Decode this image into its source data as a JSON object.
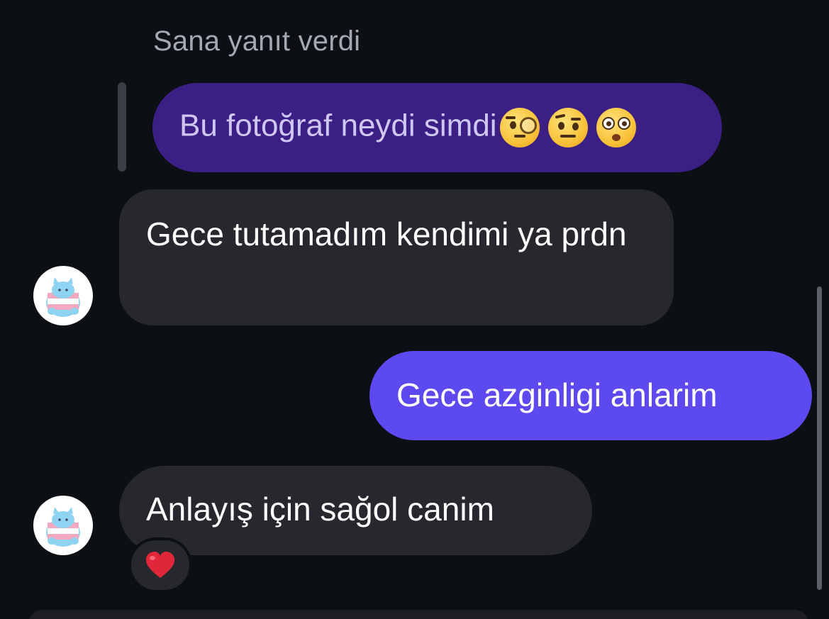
{
  "reply_context": {
    "label": "Sana yanıt verdi",
    "quoted_message": "Bu fotoğraf neydi simdi",
    "quoted_emojis": [
      "face-with-monocle-emoji",
      "face-with-raised-eyebrow-emoji",
      "flushed-face-emoji"
    ]
  },
  "messages": [
    {
      "direction": "incoming",
      "text": "Gece tutamadım kendimi ya prdn"
    },
    {
      "direction": "outgoing",
      "text": "Gece azginligi anlarim"
    },
    {
      "direction": "incoming",
      "text": "Anlayış için sağol canim",
      "reaction": "heart-emoji"
    }
  ],
  "colors": {
    "background": "#0c0f14",
    "incoming_bubble": "#26282e",
    "outgoing_bubble": "#5c4af0",
    "quoted_bubble": "#3b1f85",
    "quoted_text": "#cfc7f2",
    "meta_text": "#a4a8b2",
    "reaction_heart": "#e0273a"
  },
  "avatar_icon": "trans-flag-cat-avatar-icon"
}
